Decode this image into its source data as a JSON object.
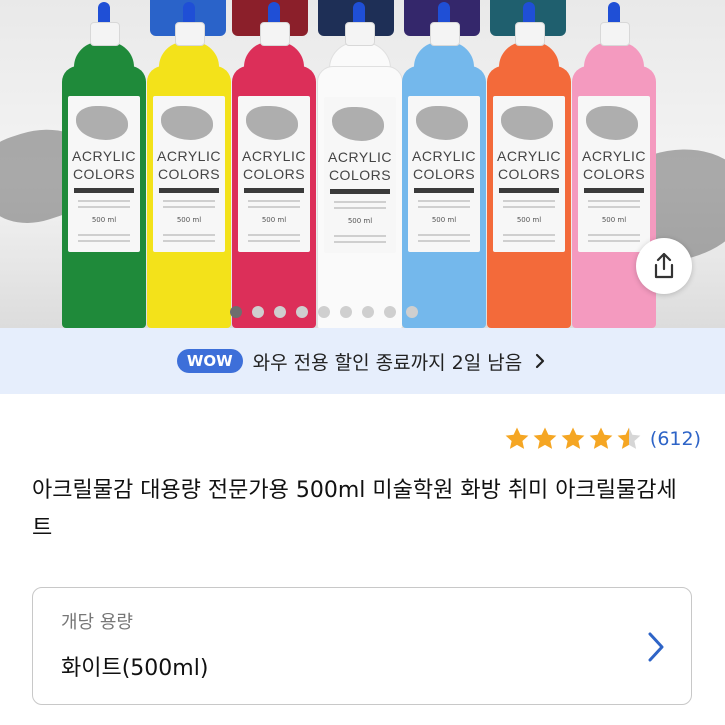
{
  "product_image": {
    "bottles": [
      {
        "color": "#1f8a3a",
        "label": [
          "ACRYLIC",
          "COLORS"
        ],
        "volume": "500 ml"
      },
      {
        "color": "#f3e21a",
        "label": [
          "ACRYLIC",
          "COLORS"
        ],
        "volume": "500 ml"
      },
      {
        "color": "#dc2f59",
        "label": [
          "ACRYLIC",
          "COLORS"
        ],
        "volume": "500 ml"
      },
      {
        "color": "#fafafa",
        "label": [
          "ACRYLIC",
          "COLORS"
        ],
        "volume": "500 ml"
      },
      {
        "color": "#74b8ec",
        "label": [
          "ACRYLIC",
          "COLORS"
        ],
        "volume": "500 ml"
      },
      {
        "color": "#f36a3a",
        "label": [
          "ACRYLIC",
          "COLORS"
        ],
        "volume": "500 ml"
      },
      {
        "color": "#f49abf",
        "label": [
          "ACRYLIC",
          "COLORS"
        ],
        "volume": "500 ml"
      }
    ],
    "back_row_colors": [
      "#2a63c9",
      "#8b1f2a",
      "#1e2f56",
      "#34276b",
      "#1f5f6e"
    ],
    "carousel": {
      "count": 9,
      "active_index": 0
    }
  },
  "share": {
    "icon": "share-icon"
  },
  "wow_banner": {
    "badge": "WOW",
    "text": "와우 전용 할인 종료까지 2일 남음",
    "icon": "chevron-right-icon"
  },
  "rating": {
    "value": 4.5,
    "max": 5,
    "star_color": "#f5a623",
    "count_text": "(612)"
  },
  "product": {
    "title": "아크릴물감 대용량 전문가용 500ml 미술학원 화방 취미 아크릴물감세트"
  },
  "option": {
    "label": "개당 용량",
    "value": "화이트(500ml)",
    "icon": "chevron-right-icon"
  },
  "colors": {
    "accent": "#3d6fd9",
    "link": "#2e64c7",
    "banner_bg": "#e6eefc"
  }
}
